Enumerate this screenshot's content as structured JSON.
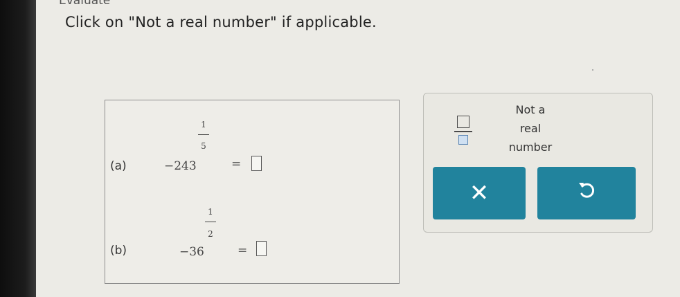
{
  "header": {
    "cut_title": "Evaluate",
    "instruction": "Click on \"Not a real number\" if applicable."
  },
  "problems": [
    {
      "label": "(a)",
      "base": "−243",
      "exp_num": "1",
      "exp_den": "5",
      "equals": "="
    },
    {
      "label": "(b)",
      "base": "−36",
      "exp_num": "1",
      "exp_den": "2",
      "equals": "="
    }
  ],
  "tools": {
    "fraction_icon": "fraction-template-icon",
    "not_real_lines": [
      "Not a",
      "real",
      "number"
    ],
    "clear_icon": "✕",
    "undo_icon": "↺"
  },
  "colors": {
    "button_teal": "#21839d",
    "background": "#ecebe6"
  }
}
